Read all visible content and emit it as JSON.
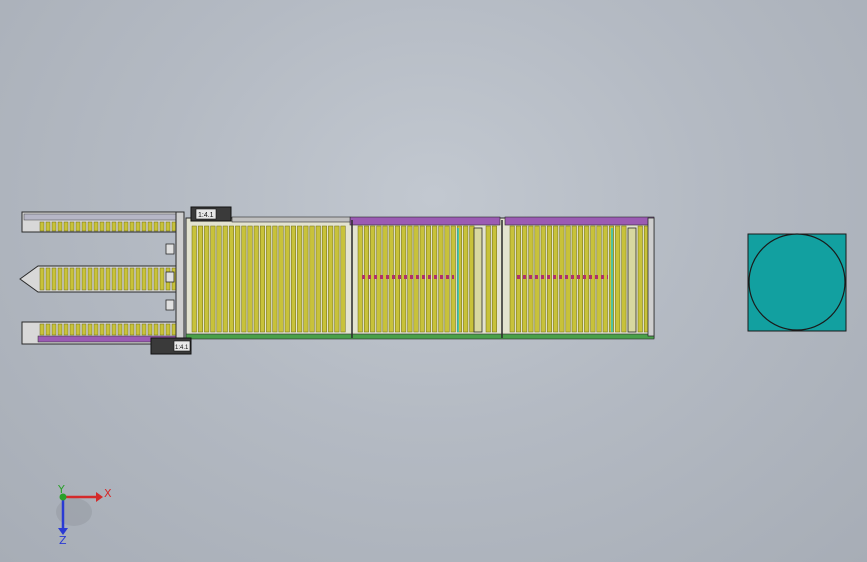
{
  "viewport": {
    "background_top": "#c2c8d0",
    "background_bottom": "#a7adb6"
  },
  "model": {
    "roller_color": "#c8c23a",
    "roller_dark": "#6d6a12",
    "rail_purple": "#9b5bb3",
    "rail_green": "#4aa04a",
    "frame_dark": "#2a2a2a",
    "pallet_fill": "#12a0a0",
    "pallet_border": "#1a1a1a",
    "motor_label_top": "1:4.1",
    "motor_label_bottom": "1:4.1"
  },
  "triad": {
    "x_label": "X",
    "y_label": "Y",
    "z_label": "Z",
    "x_color": "#d42a2a",
    "y_color": "#2aa02a",
    "z_color": "#2a3ad4"
  }
}
